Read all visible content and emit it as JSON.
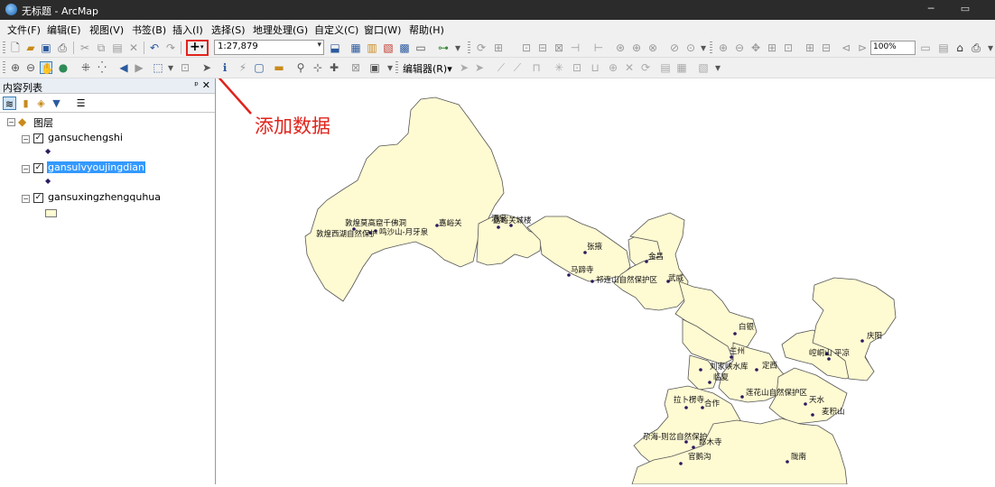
{
  "window": {
    "title": "无标题 - ArcMap",
    "min": "─",
    "restore": "▭"
  },
  "menu": [
    "文件(F)",
    "编辑(E)",
    "视图(V)",
    "书签(B)",
    "插入(I)",
    "选择(S)",
    "地理处理(G)",
    "自定义(C)",
    "窗口(W)",
    "帮助(H)"
  ],
  "toolbar": {
    "scale": "1:27,879",
    "zoom": "100%",
    "editor_label": "编辑器(R)▾"
  },
  "toc": {
    "title": "内容列表",
    "pin": "𝟡",
    "close": "✕",
    "root": "图层",
    "layers": [
      {
        "name": "gansuchengshi"
      },
      {
        "name": "gansulvyoujingdian"
      },
      {
        "name": "gansuxingzhengquhua"
      }
    ]
  },
  "annotation": "添加数据",
  "map": {
    "colors": {
      "fill": "#fefad2",
      "stroke": "#555555",
      "point": "#2b1a5e",
      "arrow": "#e0231b"
    },
    "labels": [
      "敦煌莫高窟千佛洞",
      "敦煌西湖自然保护",
      "鸣沙山-月牙泉",
      "嘉峪关",
      "酒泉",
      "嘉峪关城楼",
      "张掖",
      "金昌",
      "马蹄寺",
      "祁连山自然保护区",
      "武威",
      "白银",
      "兰州",
      "刘家峡水库",
      "临夏",
      "定西",
      "庆阳",
      "崆峒山",
      "平凉",
      "拉卜楞寺",
      "合作",
      "莲花山自然保护区",
      "天水",
      "麦积山",
      "尕海-则岔自然保护",
      "郎木寺",
      "官鹅沟",
      "陇南"
    ]
  }
}
